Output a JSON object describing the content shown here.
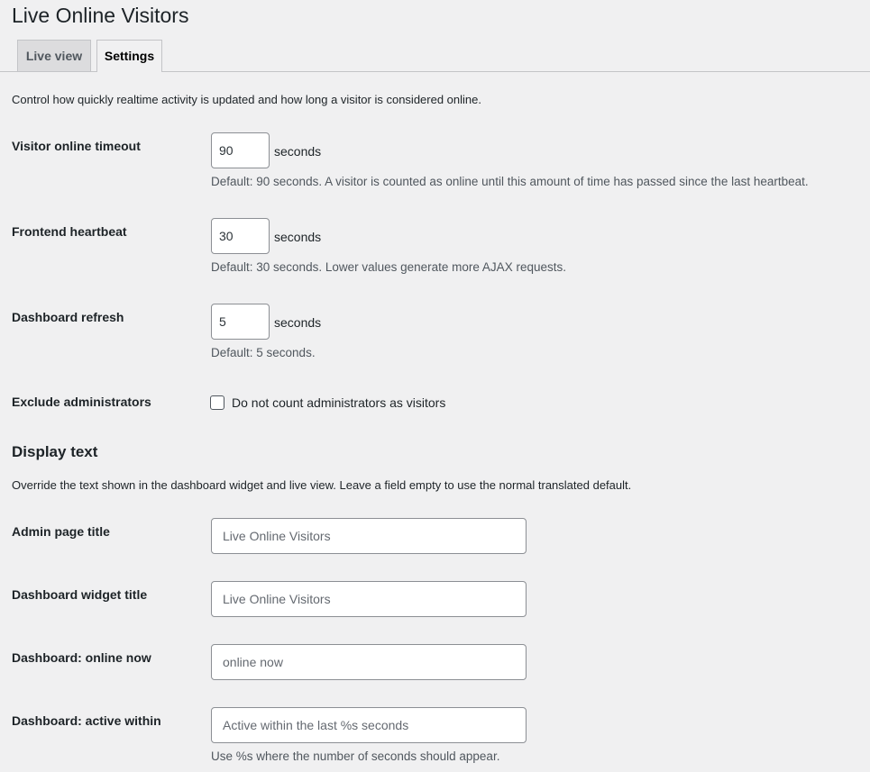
{
  "page": {
    "title": "Live Online Visitors"
  },
  "tabs": [
    {
      "label": "Live view",
      "active": false
    },
    {
      "label": "Settings",
      "active": true
    }
  ],
  "intro": "Control how quickly realtime activity is updated and how long a visitor is considered online.",
  "fields": {
    "visitor_timeout": {
      "label": "Visitor online timeout",
      "value": "90",
      "unit": "seconds",
      "help": "Default: 90 seconds. A visitor is counted as online until this amount of time has passed since the last heartbeat."
    },
    "frontend_heartbeat": {
      "label": "Frontend heartbeat",
      "value": "30",
      "unit": "seconds",
      "help": "Default: 30 seconds. Lower values generate more AJAX requests."
    },
    "dashboard_refresh": {
      "label": "Dashboard refresh",
      "value": "5",
      "unit": "seconds",
      "help": "Default: 5 seconds."
    },
    "exclude_admins": {
      "label": "Exclude administrators",
      "checkbox_label": "Do not count administrators as visitors",
      "checked": false
    }
  },
  "display_text": {
    "title": "Display text",
    "intro": "Override the text shown in the dashboard widget and live view. Leave a field empty to use the normal translated default.",
    "admin_page_title": {
      "label": "Admin page title",
      "placeholder": "Live Online Visitors"
    },
    "dashboard_widget_title": {
      "label": "Dashboard widget title",
      "placeholder": "Live Online Visitors"
    },
    "online_now": {
      "label": "Dashboard: online now",
      "placeholder": "online now"
    },
    "active_within": {
      "label": "Dashboard: active within",
      "placeholder": "Active within the last %s seconds",
      "help": "Use %s where the number of seconds should appear."
    }
  }
}
